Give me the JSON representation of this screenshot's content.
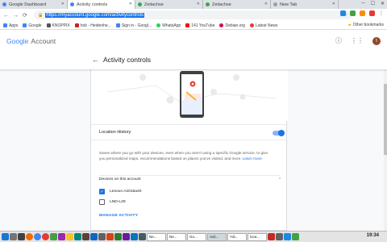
{
  "tabs": [
    {
      "label": "Google Dashboard",
      "color": "#4285f4",
      "active": false
    },
    {
      "label": "Activity controls",
      "color": "#4285f4",
      "active": true
    },
    {
      "label": "Zeitachse",
      "color": "#34a853",
      "active": false
    },
    {
      "label": "Zeitachse",
      "color": "#34a853",
      "active": false
    },
    {
      "label": "New Tab",
      "color": "#9aa0a6",
      "active": false
    }
  ],
  "address": {
    "url": "https://myaccount.google.com/activitycontrols"
  },
  "bookmarks": [
    {
      "label": "Apps",
      "color": "#4285f4"
    },
    {
      "label": "Google",
      "color": "#4285f4"
    },
    {
      "label": "KNOPPIX",
      "color": "#555"
    },
    {
      "label": "hsb - Heidenhe...",
      "color": "#c62828"
    },
    {
      "label": "Sign in - Googl...",
      "color": "#4285f4"
    },
    {
      "label": "WhatsApp",
      "color": "#25d366"
    },
    {
      "label": "141 YouTube",
      "color": "#ff0000"
    },
    {
      "label": "Debian.org",
      "color": "#d70751"
    },
    {
      "label": "Latest News",
      "color": "#e53935"
    }
  ],
  "other_bookmarks": "Other bookmarks",
  "header": {
    "logo_google": "Google",
    "logo_account": "Account",
    "avatar_letter": "I"
  },
  "page": {
    "title": "Activity controls"
  },
  "location_history": {
    "label": "Location History",
    "enabled": true
  },
  "description": {
    "text": "Saves where you go with your devices, even when you aren't using a specific Google service, to give you personalized maps, recommendations based on places you've visited, and more.",
    "learn_more": "Learn more"
  },
  "devices": {
    "heading": "Devices on this account",
    "items": [
      {
        "name": "Lenovo A2016a40",
        "checked": true
      },
      {
        "name": "LND-L29",
        "checked": false
      }
    ]
  },
  "manage_activity": "MANAGE ACTIVITY",
  "taskbar": {
    "windows": [
      "Ne...",
      "Ne...",
      "Go...",
      "Acti...",
      "Ydi...",
      "loca..."
    ],
    "clock": "19:34"
  }
}
